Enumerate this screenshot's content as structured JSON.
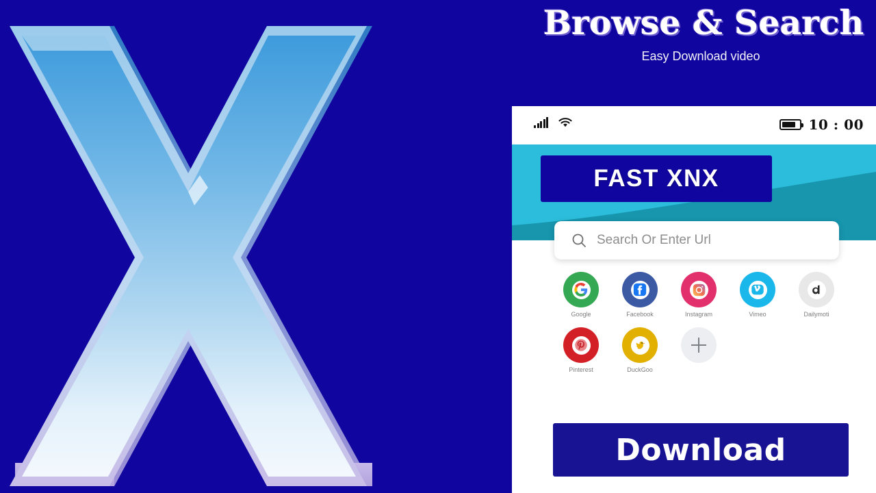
{
  "theme": {
    "navy": "#10069F",
    "teal_light": "#2BBDDB",
    "teal_dark": "#1796AE",
    "button_navy": "#181393",
    "white": "#FFFFFF"
  },
  "header": {
    "title": "Browse & Search",
    "subtitle": "Easy Download video"
  },
  "logo": {
    "letter": "X",
    "name": "app-logo-x"
  },
  "phone": {
    "statusbar": {
      "signal_icon": "signal-bars-icon",
      "wifi_icon": "wifi-icon",
      "battery_icon": "battery-icon",
      "time": "10 : 00"
    },
    "app_banner": {
      "label": "FAST XNX"
    },
    "search": {
      "icon": "search-icon",
      "placeholder": "Search Or Enter Url",
      "value": ""
    },
    "shortcuts": [
      {
        "label": "Google",
        "icon": "google-icon",
        "ring": "#34A853",
        "inner_bg": "#FFFFFF"
      },
      {
        "label": "Facebook",
        "icon": "facebook-icon",
        "ring": "#3B5AA3",
        "inner_bg": "#FFFFFF"
      },
      {
        "label": "Instagram",
        "icon": "instagram-icon",
        "ring": "#E1306C",
        "inner_bg": "#FFFFFF"
      },
      {
        "label": "Vimeo",
        "icon": "vimeo-icon",
        "ring": "#1AB7EA",
        "inner_bg": "#FFFFFF"
      },
      {
        "label": "Dailymoti",
        "icon": "dailymotion-icon",
        "ring": "#E6E6E6",
        "inner_bg": "#FFFFFF"
      },
      {
        "label": "Pinterest",
        "icon": "pinterest-icon",
        "ring": "#D32027",
        "inner_bg": "#FFFFFF"
      },
      {
        "label": "DuckGoo",
        "icon": "duckduckgo-icon",
        "ring": "#E2B000",
        "inner_bg": "#FFFFFF"
      }
    ],
    "add_shortcut": {
      "icon": "plus-icon",
      "label": ""
    },
    "download_button": {
      "label": "Download"
    }
  }
}
